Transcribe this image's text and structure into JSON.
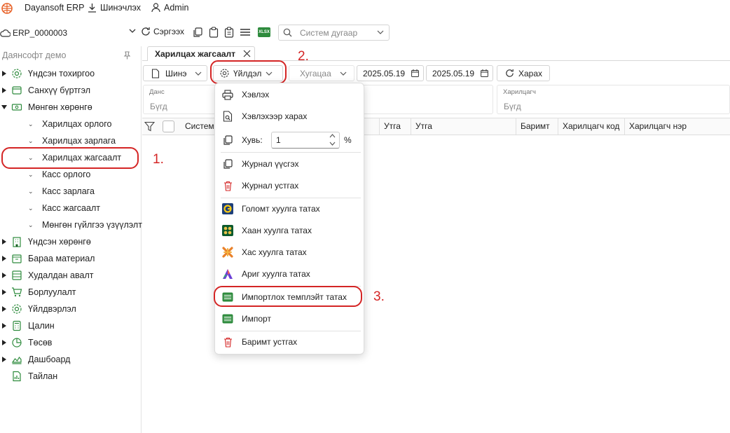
{
  "topbar": {
    "app_name": "Dayansoft ERP",
    "download_label": "Шинэчлэх",
    "user_label": "Admin"
  },
  "bar2": {
    "company_code": "ERP_0000003",
    "refresh_label": "Сэргээх",
    "system_search_placeholder": "Систем дугаар",
    "xlsx_badge": "XLSX"
  },
  "sidebar": {
    "title": "Даянсофт демо",
    "items": [
      {
        "label": "Үндсэн тохиргоо"
      },
      {
        "label": "Санхүү бүртгэл"
      },
      {
        "label": "Мөнгөн хөрөнгө"
      },
      {
        "label": "Харилцах орлого"
      },
      {
        "label": "Харилцах зарлага"
      },
      {
        "label": "Харилцах жагсаалт"
      },
      {
        "label": "Касс орлого"
      },
      {
        "label": "Касс зарлага"
      },
      {
        "label": "Касс жагсаалт"
      },
      {
        "label": "Мөнгөн гүйлгээ үзүүлэлт"
      },
      {
        "label": "Үндсэн хөрөнгө"
      },
      {
        "label": "Бараа материал"
      },
      {
        "label": "Худалдан авалт"
      },
      {
        "label": "Борлуулалт"
      },
      {
        "label": "Үйлдвэрлэл"
      },
      {
        "label": "Цалин"
      },
      {
        "label": "Төсөв"
      },
      {
        "label": "Дашбоард"
      },
      {
        "label": "Тайлан"
      }
    ]
  },
  "tab": {
    "label": "Харилцах жагсаалт"
  },
  "toolbar": {
    "new_label": "Шинэ",
    "actions_label": "Үйлдэл",
    "period_placeholder": "Хугацаа",
    "date_from": "2025.05.19",
    "date_to": "2025.05.19",
    "view_label": "Харах"
  },
  "filters": {
    "account_label": "Данс",
    "account_placeholder": "Бүгд",
    "partner_label": "Харилцагч",
    "partner_placeholder": "Бүгд"
  },
  "table": {
    "headers": [
      "Систем",
      "Утга",
      "Утга",
      "Баримт",
      "Харилцагч код",
      "Харилцагч нэр"
    ]
  },
  "menu": {
    "print": "Хэвлэх",
    "print_preview": "Хэвлэхээр харах",
    "scale_label": "Хувь:",
    "scale_value": "1",
    "scale_unit": "%",
    "journal_create": "Журнал үүсгэх",
    "journal_delete": "Журнал устгах",
    "golomt": "Голомт хуулга татах",
    "khaan": "Хаан хуулга татах",
    "khas": "Хас хуулга татах",
    "arig": "Ариг хуулга татах",
    "import_template": "Импортлох темплэйт татах",
    "import": "Импорт",
    "delete_doc": "Баримт устгах"
  },
  "annotations": {
    "step1": "1.",
    "step2": "2.",
    "step3": "3."
  },
  "colors": {
    "accent_green": "#2e8b3d",
    "annotation_red": "#d42525",
    "logo_orange": "#e8632a"
  }
}
